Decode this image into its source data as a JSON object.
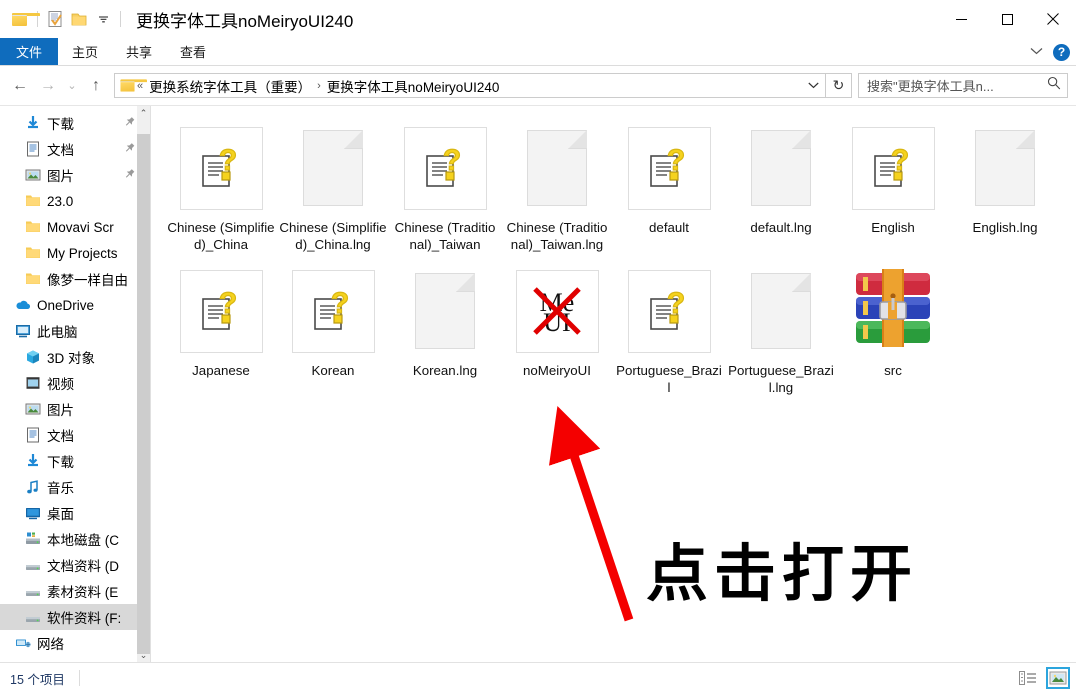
{
  "window": {
    "title": "更换字体工具noMeiryoUI240",
    "quick_access": [
      {
        "name": "folder-icon",
        "label": "folder"
      },
      {
        "name": "properties-icon",
        "label": "properties"
      },
      {
        "name": "new-folder-icon",
        "label": "new folder"
      },
      {
        "name": "customize-qat-dropdown-icon",
        "label": "▾"
      }
    ],
    "controls": {
      "minimize": "—",
      "maximize": "▢",
      "close": "✕"
    }
  },
  "ribbon": {
    "tabs": [
      {
        "label": "文件",
        "active": true
      },
      {
        "label": "主页",
        "active": false
      },
      {
        "label": "共享",
        "active": false
      },
      {
        "label": "查看",
        "active": false
      }
    ],
    "collapse_chevron": "⌄",
    "help_label": "?"
  },
  "address": {
    "back": "←",
    "forward": "→",
    "recent": "⌄",
    "up": "↑",
    "crumb_overflow": "«",
    "crumbs": [
      {
        "label": "更换系统字体工具（重要）"
      },
      {
        "label": "更换字体工具noMeiryoUI240"
      }
    ],
    "crumb_separator": "›",
    "dropdown": "⌄",
    "refresh": "↻"
  },
  "search": {
    "placeholder": "搜索\"更换字体工具n...",
    "icon": "search-icon"
  },
  "sidebar": {
    "items": [
      {
        "label": "下载",
        "icon": "download-icon",
        "pinned": true,
        "level": 1,
        "selected": false
      },
      {
        "label": "文档",
        "icon": "document-icon",
        "pinned": true,
        "level": 1,
        "selected": false
      },
      {
        "label": "图片",
        "icon": "picture-icon",
        "pinned": true,
        "level": 1,
        "selected": false
      },
      {
        "label": "23.0",
        "icon": "folder-icon",
        "pinned": false,
        "level": 1,
        "selected": false
      },
      {
        "label": "Movavi Scr",
        "icon": "folder-icon",
        "pinned": false,
        "level": 1,
        "selected": false
      },
      {
        "label": "My Projects",
        "icon": "folder-icon",
        "pinned": false,
        "level": 1,
        "selected": false
      },
      {
        "label": "像梦一样自由",
        "icon": "folder-icon",
        "pinned": false,
        "level": 1,
        "selected": false
      },
      {
        "label": "OneDrive",
        "icon": "onedrive-cloud-icon",
        "pinned": false,
        "level": 0,
        "selected": false
      },
      {
        "label": "此电脑",
        "icon": "this-pc-icon",
        "pinned": false,
        "level": 0,
        "selected": false
      },
      {
        "label": "3D 对象",
        "icon": "3d-objects-icon",
        "pinned": false,
        "level": 1,
        "selected": false
      },
      {
        "label": "视频",
        "icon": "video-icon",
        "pinned": false,
        "level": 1,
        "selected": false
      },
      {
        "label": "图片",
        "icon": "picture-icon",
        "pinned": false,
        "level": 1,
        "selected": false
      },
      {
        "label": "文档",
        "icon": "document-icon",
        "pinned": false,
        "level": 1,
        "selected": false
      },
      {
        "label": "下载",
        "icon": "download-icon",
        "pinned": false,
        "level": 1,
        "selected": false
      },
      {
        "label": "音乐",
        "icon": "music-icon",
        "pinned": false,
        "level": 1,
        "selected": false
      },
      {
        "label": "桌面",
        "icon": "desktop-icon",
        "pinned": false,
        "level": 1,
        "selected": false
      },
      {
        "label": "本地磁盘 (C",
        "icon": "system-drive-icon",
        "pinned": false,
        "level": 1,
        "selected": false
      },
      {
        "label": "文档资料 (D",
        "icon": "drive-icon",
        "pinned": false,
        "level": 1,
        "selected": false
      },
      {
        "label": "素材资料 (E",
        "icon": "drive-icon",
        "pinned": false,
        "level": 1,
        "selected": false
      },
      {
        "label": "软件资料 (F:",
        "icon": "drive-icon",
        "pinned": false,
        "level": 1,
        "selected": true
      },
      {
        "label": "网络",
        "icon": "network-icon",
        "pinned": false,
        "level": 0,
        "selected": false
      }
    ],
    "scroll_up": "⌃",
    "scroll_down": "⌄"
  },
  "files": [
    {
      "name": "Chinese (Simplified)_China",
      "icon": "unknown-file-icon"
    },
    {
      "name": "Chinese (Simplified)_China.lng",
      "icon": "blank-document-icon"
    },
    {
      "name": "Chinese (Traditional)_Taiwan",
      "icon": "unknown-file-icon"
    },
    {
      "name": "Chinese (Traditional)_Taiwan.lng",
      "icon": "blank-document-icon"
    },
    {
      "name": "default",
      "icon": "unknown-file-icon"
    },
    {
      "name": "default.lng",
      "icon": "blank-document-icon"
    },
    {
      "name": "English",
      "icon": "unknown-file-icon"
    },
    {
      "name": "English.lng",
      "icon": "blank-document-icon"
    },
    {
      "name": "Japanese",
      "icon": "unknown-file-icon"
    },
    {
      "name": "Korean",
      "icon": "unknown-file-icon"
    },
    {
      "name": "Korean.lng",
      "icon": "blank-document-icon"
    },
    {
      "name": "noMeiryoUI",
      "icon": "nomeiryoui-app-icon"
    },
    {
      "name": "Portuguese_Brazil",
      "icon": "unknown-file-icon"
    },
    {
      "name": "Portuguese_Brazil.lng",
      "icon": "blank-document-icon"
    },
    {
      "name": "src",
      "icon": "winrar-archive-icon"
    }
  ],
  "annotation": {
    "text": "点击打开",
    "arrow_color": "#f40000",
    "text_color": "#000000"
  },
  "status": {
    "item_count": "15 个项目",
    "views": [
      {
        "name": "details-view",
        "active": false
      },
      {
        "name": "large-icons-view",
        "active": true
      }
    ]
  }
}
